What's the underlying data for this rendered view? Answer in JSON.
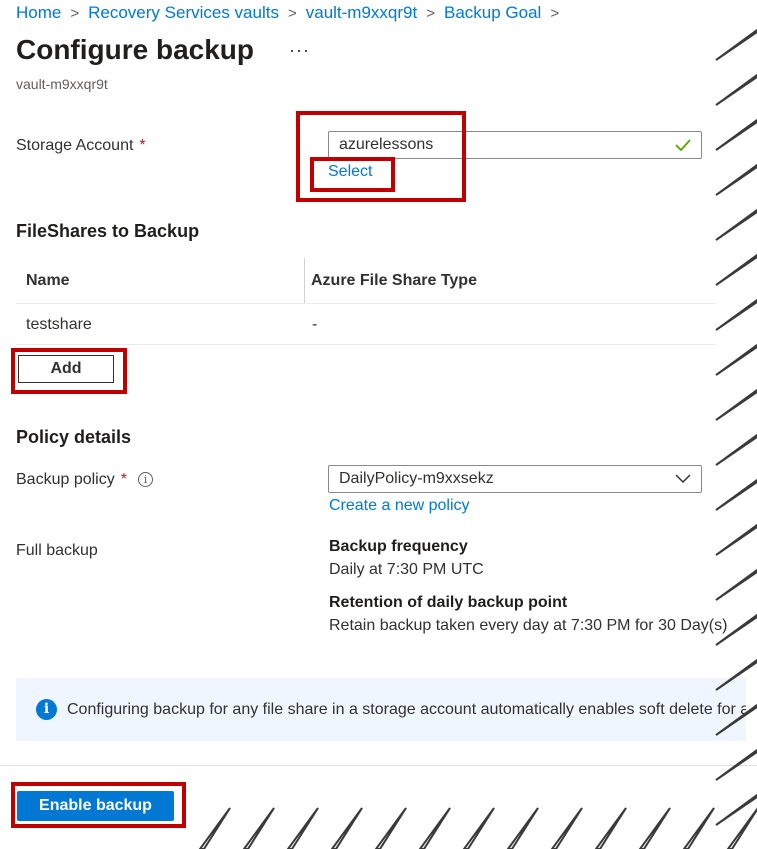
{
  "breadcrumb": {
    "items": [
      "Home",
      "Recovery Services vaults",
      "vault-m9xxqr9t",
      "Backup Goal"
    ],
    "separator": ">"
  },
  "page": {
    "title": "Configure backup",
    "more_label": "···",
    "subtitle": "vault-m9xxqr9t"
  },
  "storage": {
    "label": "Storage Account",
    "required": "*",
    "value": "azurelessons",
    "valid_icon": "check-icon",
    "select_link": "Select"
  },
  "fileshares": {
    "heading": "FileShares to Backup",
    "columns": [
      "Name",
      "Azure File Share Type"
    ],
    "rows": [
      [
        "testshare",
        "-"
      ]
    ],
    "add_button": "Add"
  },
  "policy": {
    "heading": "Policy details",
    "label": "Backup policy",
    "required": "*",
    "info_icon": "info-icon",
    "selected": "DailyPolicy-m9xxsekz",
    "create_link": "Create a new policy",
    "full_backup_label": "Full backup",
    "frequency_title": "Backup frequency",
    "frequency_value": "Daily at 7:30 PM UTC",
    "retention_title": "Retention of daily backup point",
    "retention_value": "Retain backup taken every day at 7:30 PM for 30 Day(s)"
  },
  "info_banner": {
    "text": "Configuring backup for any file share in a storage account automatically enables soft delete for all file"
  },
  "footer": {
    "enable_button": "Enable backup"
  },
  "colors": {
    "accent": "#0078d4",
    "highlight": "#c00000",
    "required": "#a4262c",
    "valid": "#57a300",
    "info_bg": "#f0f6ff"
  }
}
